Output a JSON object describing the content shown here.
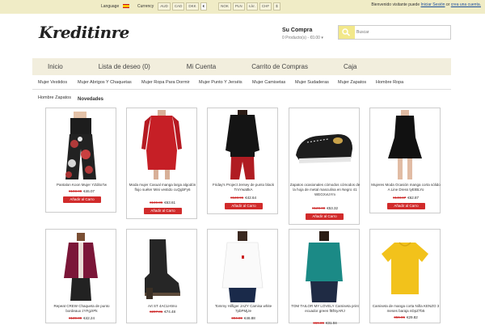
{
  "topbar": {
    "language_label": "Language",
    "currency_label": "Currency",
    "currencies": [
      "AUD",
      "CAD",
      "DKK",
      "€",
      "NOK",
      "PLN",
      "s.kr.",
      "CHF",
      "$"
    ],
    "welcome_text": "Bienvenido visitante puede",
    "login_link": "Iniciar Sesión",
    "or_text": "or",
    "register_link": "crea una cuenta."
  },
  "header": {
    "logo": "Kreditinre",
    "cart_title": "Su Compra",
    "cart_summary": "0 Producto(s) - €0.00 ▾",
    "search_placeholder": "Buscar"
  },
  "nav": {
    "items": [
      "Inicio",
      "Lista de deseo (0)",
      "Mi Cuenta",
      "Carrito de Compras",
      "Caja"
    ]
  },
  "categories": [
    "Mujer Vestidos",
    "Mujer Abrigos Y Chaquetas",
    "Mujer Ropa Para Dormir",
    "Mujer Punto Y Jerséis",
    "Mujer Camisetas",
    "Mujer Sudaderas",
    "Mujer Zapatos",
    "Hombre Ropa",
    "Hombre Zapatos"
  ],
  "section_title": "Novedades",
  "add_label": "Añadir al Carro",
  "products": [
    {
      "name": "Pantalon Koon Mujer YZdito7w",
      "old": "€103.89",
      "new": "€46.07"
    },
    {
      "name": "Moda mujer Casual manga larga algodón flojo suéter Mini vestido cuQgbFy6",
      "old": "€169.86",
      "new": "€63.61"
    },
    {
      "name": "Friday's Project Jersey de punto black TmYwattkA",
      "old": "€123.96",
      "new": "€42.64"
    },
    {
      "name": "Zapatos ocasionales cómodos cómodos de la hoja de metal masculina en Negro 41 WEGXvUYm",
      "old": "€128.00",
      "new": "€53.32"
    },
    {
      "name": "Mujeres Moda Ocasión manga corta sólido A Line Dress tyEIBLYo",
      "old": "€148.87",
      "new": "€62.87"
    },
    {
      "name": "Repeat CREW Chaqueta de punto bordeaux zYFgzIPk",
      "old": "€139.89",
      "new": "€42.24"
    },
    {
      "name": "Art ST 4ACLHtmo",
      "old": "€207.81",
      "new": "€74.48"
    },
    {
      "name": "Tommy Hilfiger JAZY Camisa white 7pbPMjJe",
      "old": "€94.89",
      "new": "€46.88"
    },
    {
      "name": "TOM TAILOR MY LOVELY Camiseta print ecuador green fBfSyARJ",
      "old": "€69.89",
      "new": "€31.04"
    },
    {
      "name": "Camiseta de manga corta Niña KENZO 3 meses baraja nDpZ7b5",
      "old": "€56.06",
      "new": "€29.82"
    }
  ],
  "colors": {
    "topbar": "#f0ecc6",
    "nav": "#f2eedd",
    "button": "#d12b2b",
    "old_price": "#cc2222"
  }
}
